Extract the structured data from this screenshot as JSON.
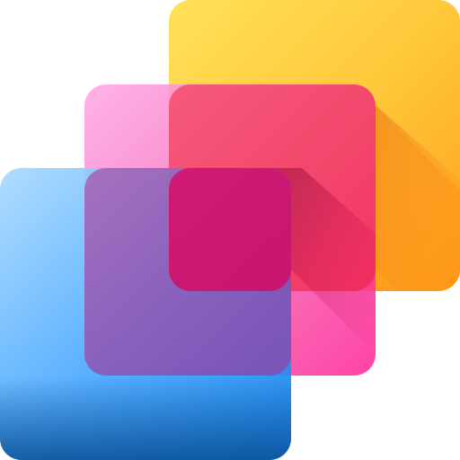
{
  "icon": {
    "name": "layers-icon",
    "layers": [
      {
        "id": "back-layer",
        "colors": [
          "#FFE15A",
          "#FFC83A",
          "#FF9F1C"
        ]
      },
      {
        "id": "middle-layer",
        "colors": [
          "#FF9FE0",
          "#F7549A",
          "#FF2A9A"
        ]
      },
      {
        "id": "front-layer",
        "colors": [
          "#9FD4FF",
          "#3FA4FF",
          "#0E7FE8",
          "#0A4F94"
        ]
      }
    ]
  }
}
